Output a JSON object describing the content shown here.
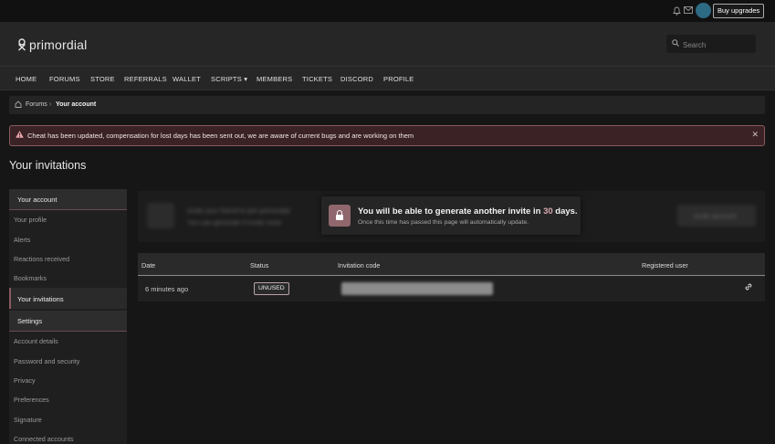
{
  "topbar": {
    "buy_label": "Buy upgrades"
  },
  "header": {
    "logo_text": "primordial",
    "search_placeholder": "Search"
  },
  "nav": {
    "items": [
      "HOME",
      "FORUMS",
      "STORE",
      "REFERRALS",
      "WALLET",
      "SCRIPTS ▾",
      "MEMBERS",
      "TICKETS",
      "DISCORD",
      "PROFILE"
    ]
  },
  "breadcrumb": {
    "root": "Forums",
    "current": "Your account"
  },
  "notice": {
    "text": "Cheat has been updated, compensation for lost days has been sent out, we are aware of current bugs and are working on them"
  },
  "page": {
    "title": "Your invitations"
  },
  "sidebar": {
    "account_header": "Your account",
    "account_links": [
      "Your profile",
      "Alerts",
      "Reactions received",
      "Bookmarks"
    ],
    "active_link": "Your invitations",
    "settings_header": "Settings",
    "settings_links": [
      "Account details",
      "Password and security",
      "Privacy",
      "Preferences",
      "Signature",
      "Connected accounts"
    ]
  },
  "invite": {
    "line1": "Invite your friend to join primordial",
    "line2": "You can generate 0 invite more",
    "button_label": "Invite account",
    "message_pre": "You will be able to generate another invite in ",
    "message_days": "30",
    "message_post": " days.",
    "message_sub": "Once this time has passed this page will automatically update."
  },
  "table": {
    "headers": [
      "Date",
      "Status",
      "Invitation code",
      "Registered user"
    ],
    "rows": [
      {
        "date": "6 minutes ago",
        "status": "UNUSED"
      }
    ]
  }
}
